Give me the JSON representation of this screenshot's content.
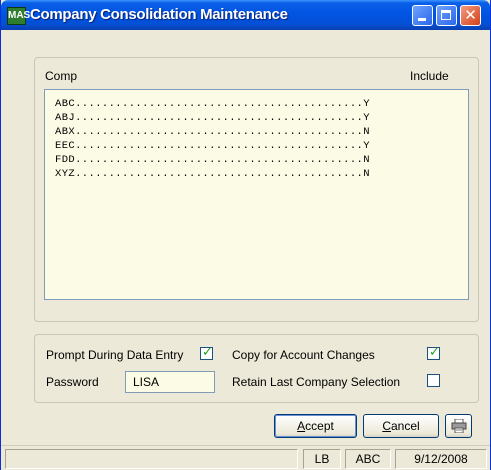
{
  "window": {
    "title": "Company Consolidation Maintenance",
    "app_icon": "MAS"
  },
  "list": {
    "col_comp": "Comp",
    "col_include": "Include",
    "rows": [
      "ABC...........................................Y",
      "ABJ...........................................Y",
      "ABX...........................................N",
      "EEC...........................................Y",
      "FDD...........................................N",
      "XYZ...........................................N"
    ]
  },
  "options": {
    "prompt_label": "Prompt During Data Entry",
    "prompt_checked": true,
    "copy_label": "Copy for Account Changes",
    "copy_checked": true,
    "retain_label": "Retain Last Company Selection",
    "retain_checked": false,
    "password_label": "Password",
    "password_value": "LISA"
  },
  "buttons": {
    "accept_first": "A",
    "accept_rest": "ccept",
    "cancel_first": "C",
    "cancel_rest": "ancel",
    "print_icon": "printer-icon"
  },
  "status": {
    "user": "LB",
    "company": "ABC",
    "date": "9/12/2008"
  },
  "colors": {
    "title_bar": "#0054e3",
    "list_bg": "#fcfce6",
    "check": "#21a121"
  }
}
